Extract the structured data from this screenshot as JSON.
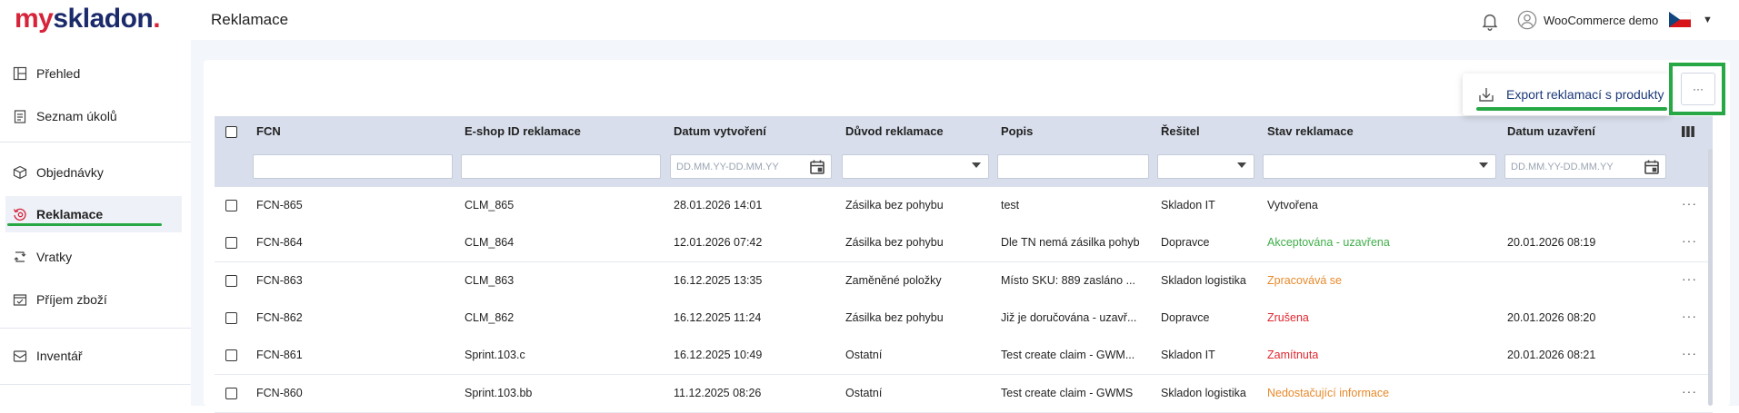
{
  "app": {
    "logo_my": "my",
    "logo_sk": "skladon",
    "logo_dot": ".",
    "page_title": "Reklamace",
    "user_name": "WooCommerce demo",
    "language_flag": "cz-flag-icon"
  },
  "sidebar": {
    "items": [
      {
        "label": "Přehled",
        "icon": "dashboard-icon"
      },
      {
        "label": "Seznam úkolů",
        "icon": "clipboard-icon"
      },
      {
        "label": "Objednávky",
        "icon": "box-icon"
      },
      {
        "label": "Reklamace",
        "icon": "return-claim-icon"
      },
      {
        "label": "Vratky",
        "icon": "returns-icon"
      },
      {
        "label": "Příjem zboží",
        "icon": "receipt-icon"
      },
      {
        "label": "Inventář",
        "icon": "inventory-icon"
      }
    ],
    "active": "Reklamace"
  },
  "toolbar": {
    "export_label": "Export reklamací s produkty",
    "more_label": "···"
  },
  "table": {
    "columns": [
      "FCN",
      "E-shop ID reklamace",
      "Datum vytvoření",
      "Důvod reklamace",
      "Popis",
      "Řešitel",
      "Stav reklamace",
      "Datum uzavření"
    ],
    "filters": {
      "date_created_placeholder": "DD.MM.YY-DD.MM.YY",
      "date_closed_placeholder": "DD.MM.YY-DD.MM.YY"
    },
    "rows": [
      {
        "fcn": "FCN-865",
        "eshop_id": "CLM_865",
        "created": "28.01.2026 14:01",
        "reason": "Zásilka bez pohybu",
        "desc": "test",
        "solver": "Skladon IT",
        "status": "Vytvořena",
        "status_color": "#222222",
        "closed": ""
      },
      {
        "fcn": "FCN-864",
        "eshop_id": "CLM_864",
        "created": "12.01.2026 07:42",
        "reason": "Zásilka bez pohybu",
        "desc": "Dle TN nemá zásilka pohyb",
        "solver": "Dopravce",
        "status": "Akceptována - uzavřena",
        "status_color": "#3fae49",
        "closed": "20.01.2026 08:19"
      },
      {
        "fcn": "FCN-863",
        "eshop_id": "CLM_863",
        "created": "16.12.2025 13:35",
        "reason": "Zaměněné položky",
        "desc": "Místo SKU: 889 zasláno ...",
        "solver": "Skladon logistika",
        "status": "Zpracovává se",
        "status_color": "#e8892b",
        "closed": ""
      },
      {
        "fcn": "FCN-862",
        "eshop_id": "CLM_862",
        "created": "16.12.2025 11:24",
        "reason": "Zásilka bez pohybu",
        "desc": "Již je doručována - uzavř...",
        "solver": "Dopravce",
        "status": "Zrušena",
        "status_color": "#e0262f",
        "closed": "20.01.2026 08:20"
      },
      {
        "fcn": "FCN-861",
        "eshop_id": "Sprint.103.c",
        "created": "16.12.2025 10:49",
        "reason": "Ostatní",
        "desc": "Test create claim - GWM...",
        "solver": "Skladon IT",
        "status": "Zamítnuta",
        "status_color": "#e0262f",
        "closed": "20.01.2026 08:21"
      },
      {
        "fcn": "FCN-860",
        "eshop_id": "Sprint.103.bb",
        "created": "11.12.2025 08:26",
        "reason": "Ostatní",
        "desc": "Test create claim - GWMS",
        "solver": "Skladon logistika",
        "status": "Nedostačující informace",
        "status_color": "#e8892b",
        "closed": ""
      }
    ],
    "row_actions_label": "···"
  }
}
